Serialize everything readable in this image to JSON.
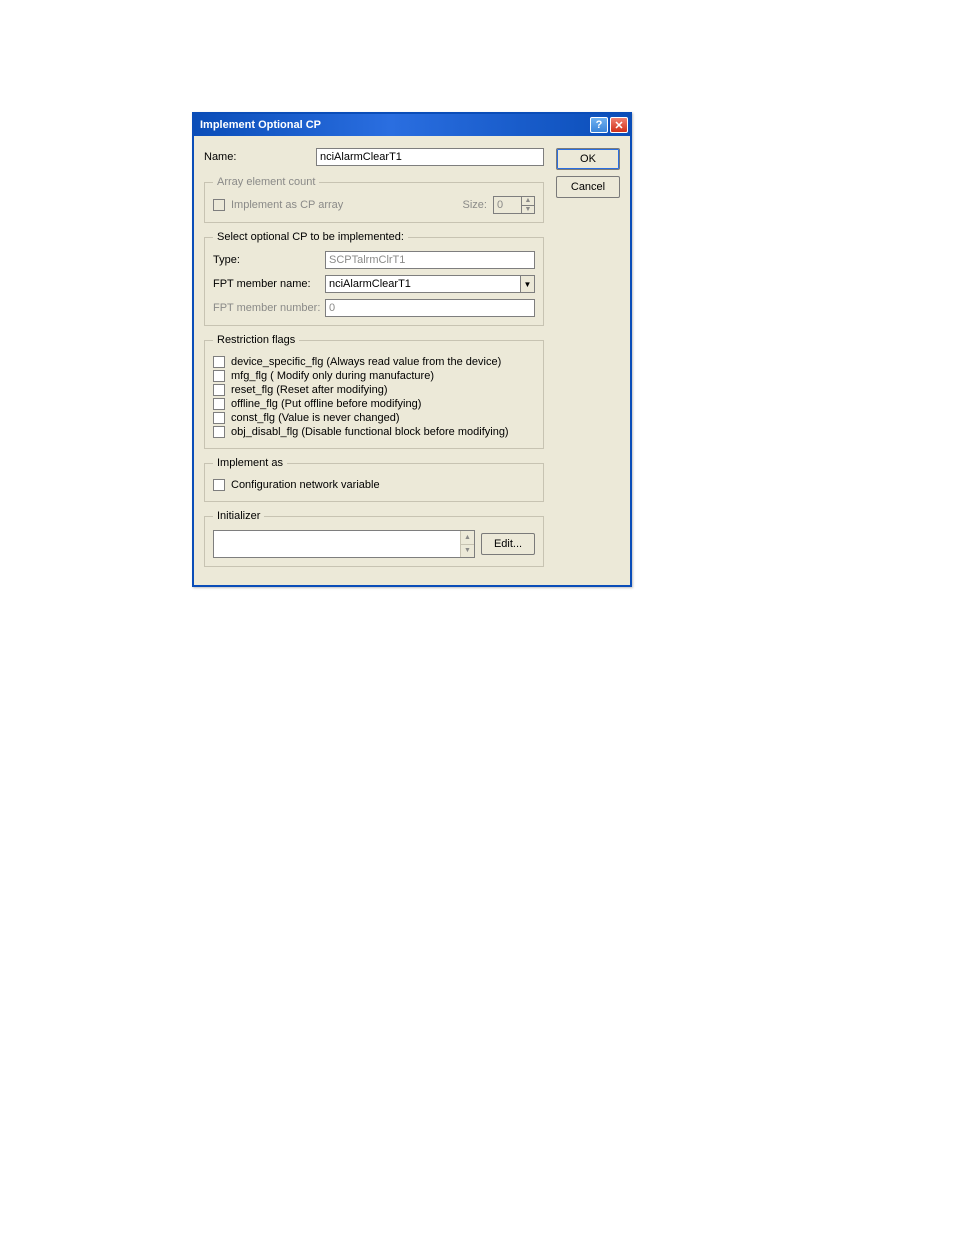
{
  "window": {
    "title": "Implement Optional CP",
    "help_symbol": "?",
    "close_symbol": "✕"
  },
  "buttons": {
    "ok": "OK",
    "cancel": "Cancel",
    "edit": "Edit..."
  },
  "name": {
    "label": "Name:",
    "value": "nciAlarmClearT1"
  },
  "array_group": {
    "legend": "Array element count",
    "implement_label": "Implement as CP array",
    "size_label": "Size:",
    "size_value": "0"
  },
  "select_group": {
    "legend": "Select optional CP to be implemented:",
    "type_label": "Type:",
    "type_value": "SCPTalrmClrT1",
    "fpt_name_label": "FPT member name:",
    "fpt_name_value": "nciAlarmClearT1",
    "fpt_num_label": "FPT member number:",
    "fpt_num_value": "0"
  },
  "restriction": {
    "legend": "Restriction flags",
    "flags": [
      "device_specific_flg  (Always read value from the device)",
      "mfg_flg  ( Modify only during manufacture)",
      "reset_flg  (Reset after modifying)",
      "offline_flg  (Put offline before modifying)",
      "const_flg  (Value is never changed)",
      "obj_disabl_flg  (Disable functional block before modifying)"
    ]
  },
  "implement_as": {
    "legend": "Implement as",
    "cnv_label": "Configuration network variable"
  },
  "initializer": {
    "legend": "Initializer"
  }
}
